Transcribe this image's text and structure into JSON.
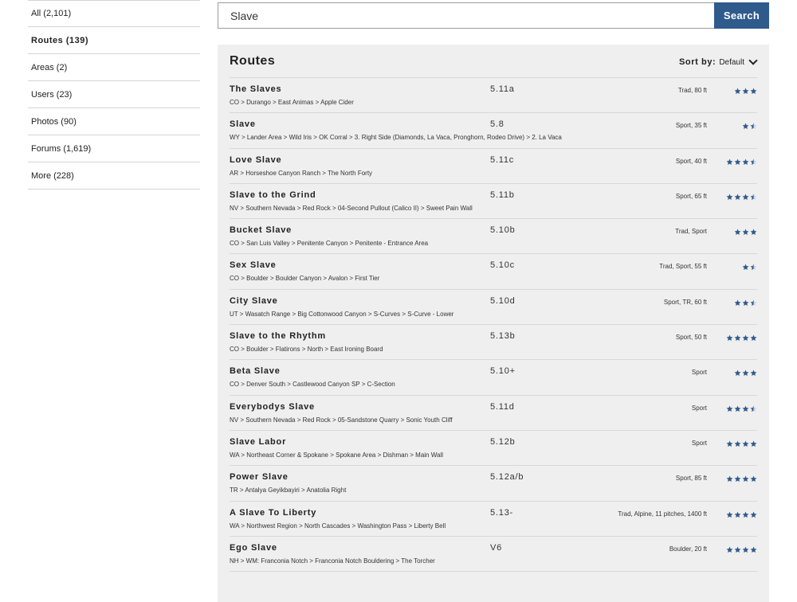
{
  "sidebar": {
    "items": [
      {
        "label": "All (2,101)"
      },
      {
        "label": "Routes (139)"
      },
      {
        "label": "Areas (2)"
      },
      {
        "label": "Users (23)"
      },
      {
        "label": "Photos (90)"
      },
      {
        "label": "Forums (1,619)"
      },
      {
        "label": "More (228)"
      }
    ]
  },
  "search": {
    "value": "Slave",
    "button_label": "Search"
  },
  "panel": {
    "title": "Routes",
    "sort_label": "Sort by:",
    "sort_value": "Default"
  },
  "colors": {
    "accent": "#2f5a8c",
    "star": "#2f5a8c"
  },
  "routes": [
    {
      "name": "The Slaves",
      "grade": "5.11a",
      "meta": "Trad, 80 ft",
      "path": "CO > Durango > East Animas > Apple Cider",
      "stars": 3
    },
    {
      "name": "Slave",
      "grade": "5.8",
      "meta": "Sport, 35 ft",
      "path": "WY > Lander Area > Wild Iris > OK Corral > 3. Right Side (Diamonds, La Vaca, Pronghorn, Rodeo Drive) > 2. La Vaca",
      "stars": 1.5
    },
    {
      "name": "Love Slave",
      "grade": "5.11c",
      "meta": "Sport, 40 ft",
      "path": "AR > Horseshoe Canyon Ranch > The North Forty",
      "stars": 3.5
    },
    {
      "name": "Slave to the Grind",
      "grade": "5.11b",
      "meta": "Sport, 65 ft",
      "path": "NV > Southern Nevada > Red Rock > 04-Second Pullout (Calico II) > Sweet Pain Wall",
      "stars": 3.5
    },
    {
      "name": "Bucket Slave",
      "grade": "5.10b",
      "meta": "Trad, Sport",
      "path": "CO > San Luis Valley > Penitente Canyon > Penitente - Entrance Area",
      "stars": 3
    },
    {
      "name": "Sex Slave",
      "grade": "5.10c",
      "meta": "Trad, Sport, 55 ft",
      "path": "CO > Boulder > Boulder Canyon > Avalon > First Tier",
      "stars": 1.5
    },
    {
      "name": "City Slave",
      "grade": "5.10d",
      "meta": "Sport, TR, 60 ft",
      "path": "UT > Wasatch Range > Big Cottonwood Canyon > S-Curves > S-Curve - Lower",
      "stars": 2.5
    },
    {
      "name": "Slave to the Rhythm",
      "grade": "5.13b",
      "meta": "Sport, 50 ft",
      "path": "CO > Boulder > Flatirons > North > East Ironing Board",
      "stars": 4
    },
    {
      "name": "Beta Slave",
      "grade": "5.10+",
      "meta": "Sport",
      "path": "CO > Denver South > Castlewood Canyon SP > C-Section",
      "stars": 3
    },
    {
      "name": "Everybodys Slave",
      "grade": "5.11d",
      "meta": "Sport",
      "path": "NV > Southern Nevada > Red Rock > 05-Sandstone Quarry > Sonic Youth Cliff",
      "stars": 3.5
    },
    {
      "name": "Slave Labor",
      "grade": "5.12b",
      "meta": "Sport",
      "path": "WA > Northeast Corner & Spokane > Spokane Area > Dishman > Main Wall",
      "stars": 4
    },
    {
      "name": "Power Slave",
      "grade": "5.12a/b",
      "meta": "Sport, 85 ft",
      "path": "TR > Antalya Geyikbayiri > Anatolia Right",
      "stars": 4
    },
    {
      "name": "A Slave To Liberty",
      "grade": "5.13-",
      "meta": "Trad, Alpine, 11 pitches, 1400 ft",
      "path": "WA > Northwest Region > North Cascades > Washington Pass > Liberty Bell",
      "stars": 4
    },
    {
      "name": "Ego Slave",
      "grade": "V6",
      "meta": "Boulder, 20 ft",
      "path": "NH > WM: Franconia Notch > Franconia Notch Bouldering > The Torcher",
      "stars": 4
    }
  ]
}
